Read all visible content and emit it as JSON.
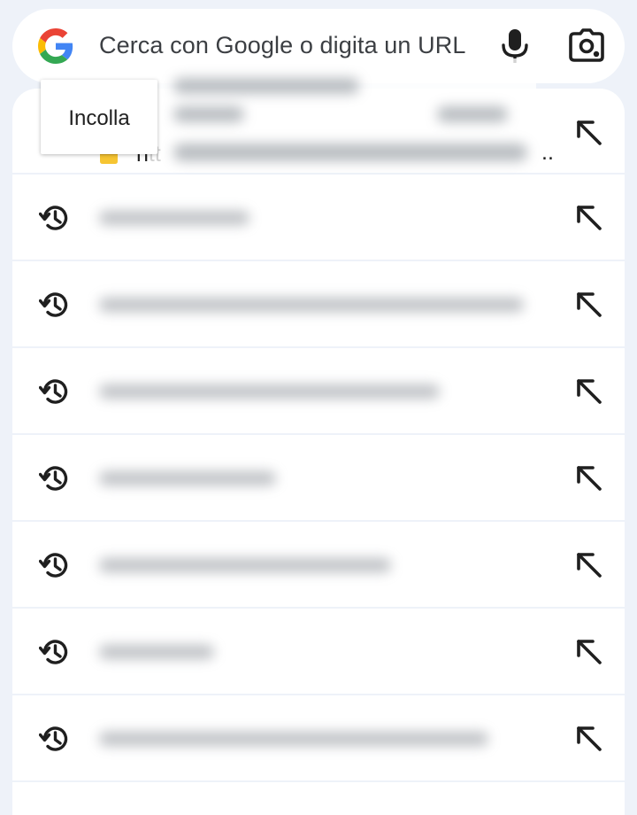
{
  "search": {
    "placeholder": "Cerca con Google o digita un URL"
  },
  "paste_menu": {
    "label": "Incolla"
  },
  "clipboard_row": {
    "visible_text": "htt",
    "ellipsis": "..",
    "icon": "clipboard-emoji-icon",
    "action_icon": "arrow-up-left-icon"
  },
  "history_rows": [
    {
      "icon": "history-icon",
      "action_icon": "arrow-up-left-icon"
    },
    {
      "icon": "history-icon",
      "action_icon": "arrow-up-left-icon"
    },
    {
      "icon": "history-icon",
      "action_icon": "arrow-up-left-icon"
    },
    {
      "icon": "history-icon",
      "action_icon": "arrow-up-left-icon"
    },
    {
      "icon": "history-icon",
      "action_icon": "arrow-up-left-icon"
    },
    {
      "icon": "history-icon",
      "action_icon": "arrow-up-left-icon"
    },
    {
      "icon": "history-icon",
      "action_icon": "arrow-up-left-icon"
    }
  ],
  "colors": {
    "background": "#eef2f9",
    "surface": "#ffffff",
    "google_blue": "#4285F4",
    "google_red": "#EA4335",
    "google_yellow": "#FBBC05",
    "google_green": "#34A853",
    "icon_dark": "#1f1f1f"
  }
}
